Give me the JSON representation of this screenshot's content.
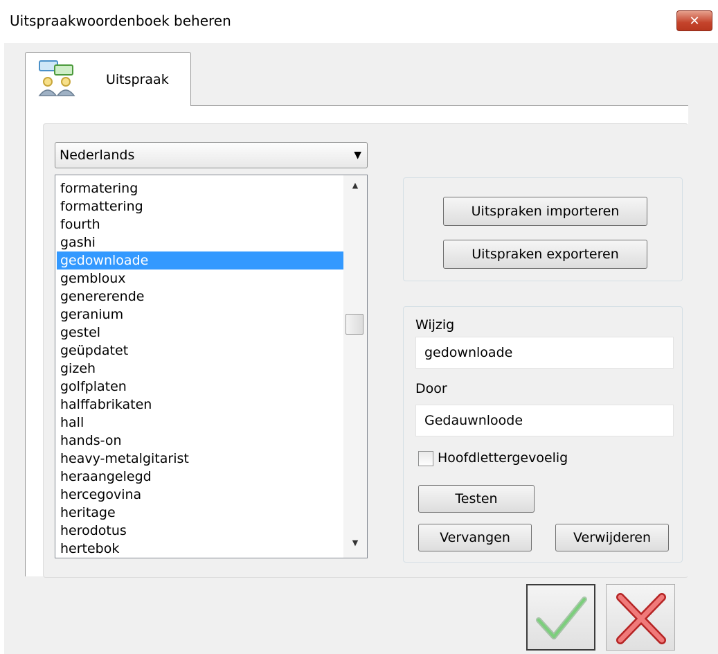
{
  "window": {
    "title": "Uitspraakwoordenboek beheren",
    "close_label": "✕"
  },
  "tab": {
    "label": "Uitspraak"
  },
  "language_select": {
    "value": "Nederlands"
  },
  "word_list": {
    "items": [
      "formatering",
      "formattering",
      "fourth",
      "gashi",
      "gedownloade",
      "gembloux",
      "genererende",
      "geranium",
      "gestel",
      "geüpdatet",
      "gizeh",
      "golfplaten",
      "halffabrikaten",
      "hall",
      "hands-on",
      "heavy-metalgitarist",
      "heraangelegd",
      "hercegovina",
      "heritage",
      "herodotus",
      "hertebok"
    ],
    "selected": "gedownloade"
  },
  "import_export": {
    "import_label": "Uitspraken importeren",
    "export_label": "Uitspraken exporteren"
  },
  "edit": {
    "wijzig_label": "Wijzig",
    "wijzig_value": "gedownloade",
    "door_label": "Door",
    "door_value": "Gedauwnloode",
    "case_label": "Hoofdlettergevoelig",
    "case_checked": false,
    "test_label": "Testen",
    "replace_label": "Vervangen",
    "delete_label": "Verwijderen"
  },
  "colors": {
    "selection": "#3399ff",
    "ok_check": "#5cb85c",
    "cancel_x": "#e05050"
  }
}
